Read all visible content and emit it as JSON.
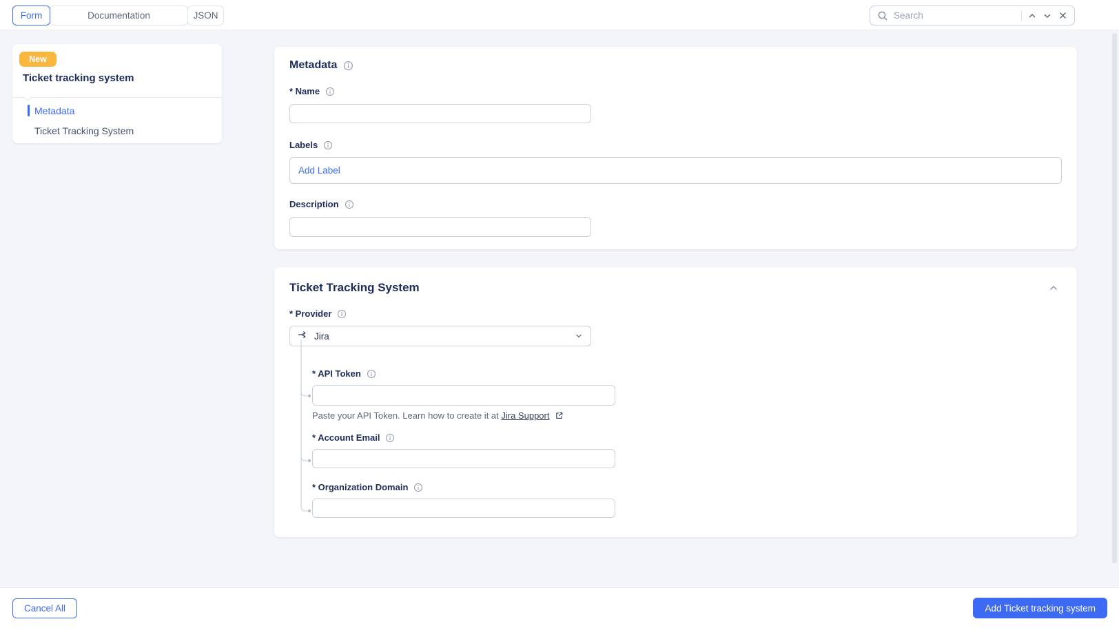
{
  "topbar": {
    "tabs": [
      {
        "label": "Form",
        "active": true
      },
      {
        "label": "Documentation",
        "active": false
      },
      {
        "label": "JSON",
        "active": false
      }
    ],
    "search": {
      "placeholder": "Search",
      "value": ""
    }
  },
  "sidebar": {
    "badge": "New",
    "title": "Ticket tracking system",
    "items": [
      {
        "label": "Metadata",
        "active": true
      },
      {
        "label": "Ticket Tracking System",
        "active": false
      }
    ]
  },
  "metadata": {
    "title": "Metadata",
    "name": {
      "label": "* Name",
      "value": ""
    },
    "labels": {
      "label": "Labels",
      "add_button": "Add Label"
    },
    "description": {
      "label": "Description",
      "value": ""
    }
  },
  "ticket_system": {
    "title": "Ticket Tracking System",
    "provider": {
      "label": "* Provider",
      "value": "Jira"
    },
    "api_token": {
      "label": "* API Token",
      "value": "",
      "help_prefix": "Paste your API Token. Learn how to create it at ",
      "help_link": "Jira Support"
    },
    "account_email": {
      "label": "* Account Email",
      "value": ""
    },
    "organization_domain": {
      "label": "* Organization Domain",
      "value": ""
    }
  },
  "footer": {
    "cancel_label": "Cancel All",
    "submit_label": "Add Ticket tracking system"
  },
  "colors": {
    "accent": "#3d6af2",
    "badge": "#fab73d",
    "heading": "#1e2c5a",
    "page_background": "#f4f5f8"
  }
}
